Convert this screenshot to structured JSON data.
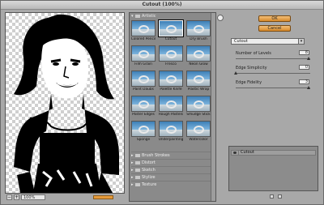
{
  "window": {
    "title": "Cutout (100%)"
  },
  "preview": {
    "zoom": "100%"
  },
  "gallery": {
    "open_category": "Artistic",
    "filters": [
      {
        "label": "Colored Pencil",
        "selected": false
      },
      {
        "label": "Cutout",
        "selected": true
      },
      {
        "label": "Dry Brush",
        "selected": false
      },
      {
        "label": "Film Grain",
        "selected": false
      },
      {
        "label": "Fresco",
        "selected": false
      },
      {
        "label": "Neon Glow",
        "selected": false
      },
      {
        "label": "Paint Daubs",
        "selected": false
      },
      {
        "label": "Palette Knife",
        "selected": false
      },
      {
        "label": "Plastic Wrap",
        "selected": false
      },
      {
        "label": "Poster Edges",
        "selected": false
      },
      {
        "label": "Rough Pastels",
        "selected": false
      },
      {
        "label": "Smudge Stick",
        "selected": false
      },
      {
        "label": "Sponge",
        "selected": false
      },
      {
        "label": "Underpainting",
        "selected": false
      },
      {
        "label": "Watercolor",
        "selected": false
      }
    ],
    "collapsed_categories": [
      "Brush Strokes",
      "Distort",
      "Sketch",
      "Stylize",
      "Texture"
    ]
  },
  "buttons": {
    "ok": "OK",
    "cancel": "Cancel"
  },
  "settings": {
    "filter_select": "Cutout",
    "params": [
      {
        "label": "Number of Levels",
        "value": "8",
        "fraction": 1.0
      },
      {
        "label": "Edge Simplicity",
        "value": "0",
        "fraction": 0.0
      },
      {
        "label": "Edge Fidelity",
        "value": "3",
        "fraction": 1.0
      }
    ]
  },
  "effects": {
    "layers": [
      {
        "name": "Cutout"
      }
    ]
  }
}
